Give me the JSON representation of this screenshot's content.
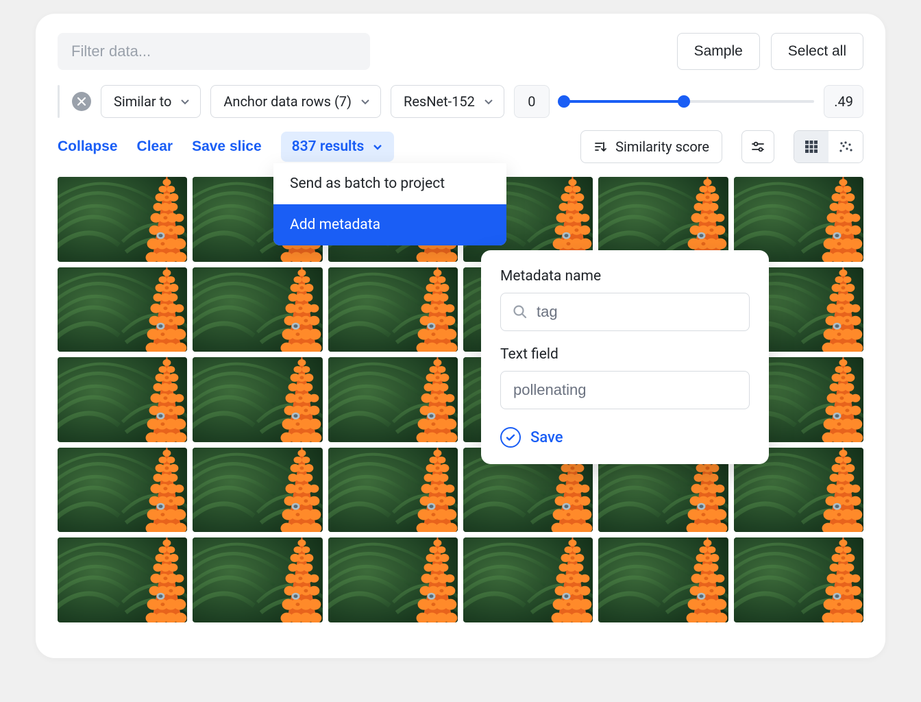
{
  "top": {
    "filter_placeholder": "Filter data...",
    "sample_label": "Sample",
    "select_all_label": "Select all"
  },
  "filters": {
    "similar_to": "Similar to",
    "anchor": "Anchor data rows (7)",
    "model": "ResNet-152",
    "range_min": "0",
    "range_max": ".49"
  },
  "actions": {
    "collapse": "Collapse",
    "clear": "Clear",
    "save_slice": "Save slice",
    "results": "837 results",
    "sort": "Similarity score"
  },
  "menu": {
    "send_batch": "Send as batch to project",
    "add_metadata": "Add metadata"
  },
  "meta_panel": {
    "name_label": "Metadata name",
    "name_value": "tag",
    "text_label": "Text field",
    "text_value": "pollenating",
    "save": "Save"
  },
  "grid": {
    "rows": 5,
    "cols": 6
  }
}
